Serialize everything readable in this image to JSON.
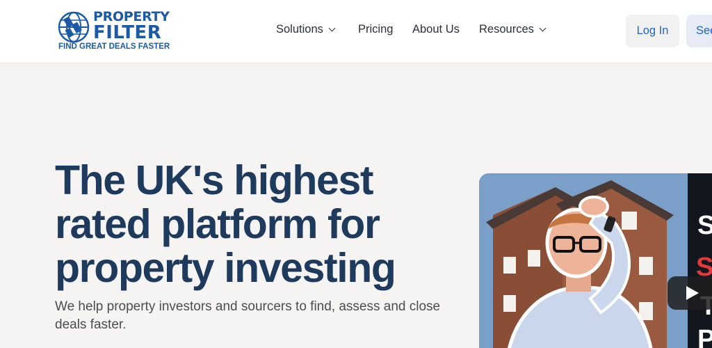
{
  "brand": {
    "word1": "PROPERTY",
    "word2": "FILTER",
    "tagline": "FIND GREAT DEALS FASTER",
    "color": "#1c5aa6"
  },
  "nav": {
    "items": [
      {
        "label": "Solutions",
        "has_dropdown": true
      },
      {
        "label": "Pricing",
        "has_dropdown": false
      },
      {
        "label": "About Us",
        "has_dropdown": false
      },
      {
        "label": "Resources",
        "has_dropdown": true
      }
    ],
    "login_label": "Log In",
    "demo_label_visible": "See"
  },
  "hero": {
    "title": "The UK's highest rated platform for property investing",
    "subtitle": "We help property investors and sourcers to find, assess and close deals faster."
  },
  "video": {
    "overlay_letters": [
      "S",
      "S",
      "T",
      "P"
    ],
    "play_icon": "play-icon"
  },
  "colors": {
    "title": "#1e3a5c",
    "link": "#2563c4",
    "background": "#f6f4f2"
  }
}
